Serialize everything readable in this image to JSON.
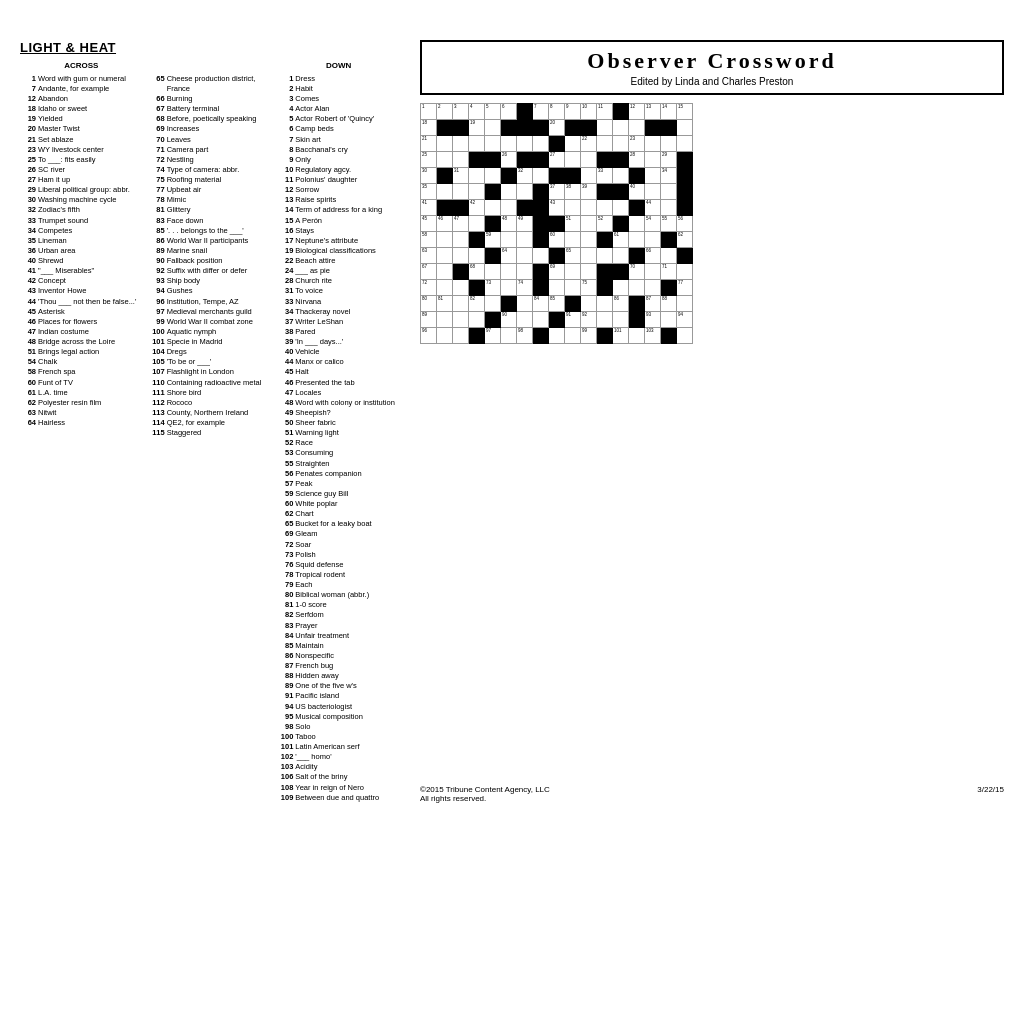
{
  "puzzle": {
    "title": "LIGHT & HEAT",
    "crossword_title": "Observer Crossword",
    "crossword_subtitle": "Edited by Linda and Charles Preston",
    "copyright": "©2015 Tribune Content Agency, LLC",
    "rights": "All rights reserved.",
    "date": "3/22/15"
  },
  "across_title": "ACROSS",
  "down_title": "DOWN",
  "across_clues": [
    {
      "num": "1",
      "text": "Word with gum or numeral"
    },
    {
      "num": "7",
      "text": "Andante, for example"
    },
    {
      "num": "12",
      "text": "Abandon"
    },
    {
      "num": "18",
      "text": "Idaho or sweet"
    },
    {
      "num": "19",
      "text": "Yielded"
    },
    {
      "num": "20",
      "text": "Master Twist"
    },
    {
      "num": "21",
      "text": "Set ablaze"
    },
    {
      "num": "23",
      "text": "WY livestock center"
    },
    {
      "num": "25",
      "text": "To ___: fits easily"
    },
    {
      "num": "26",
      "text": "SC river"
    },
    {
      "num": "27",
      "text": "Ham it up"
    },
    {
      "num": "29",
      "text": "Liberal political group: abbr."
    },
    {
      "num": "30",
      "text": "Washing machine cycle"
    },
    {
      "num": "32",
      "text": "Zodiac's fifth"
    },
    {
      "num": "33",
      "text": "Trumpet sound"
    },
    {
      "num": "34",
      "text": "Competes"
    },
    {
      "num": "35",
      "text": "Lineman"
    },
    {
      "num": "36",
      "text": "Urban area"
    },
    {
      "num": "40",
      "text": "Shrewd"
    },
    {
      "num": "41",
      "text": "\"___ Miserables\""
    },
    {
      "num": "42",
      "text": "Concept"
    },
    {
      "num": "43",
      "text": "Inventor Howe"
    },
    {
      "num": "44",
      "text": "'Thou ___ not then be false...'"
    },
    {
      "num": "45",
      "text": "Asterisk"
    },
    {
      "num": "46",
      "text": "Places for flowers"
    },
    {
      "num": "47",
      "text": "Indian costume"
    },
    {
      "num": "48",
      "text": "Bridge across the Loire"
    },
    {
      "num": "51",
      "text": "Brings legal action"
    },
    {
      "num": "54",
      "text": "Chalk"
    },
    {
      "num": "58",
      "text": "French spa"
    },
    {
      "num": "60",
      "text": "Funt of TV"
    },
    {
      "num": "61",
      "text": "L.A. time"
    },
    {
      "num": "62",
      "text": "Polyester resin film"
    },
    {
      "num": "63",
      "text": "Nitwit"
    },
    {
      "num": "64",
      "text": "Hairless"
    },
    {
      "num": "65",
      "text": "Cheese production district, France"
    },
    {
      "num": "66",
      "text": "Burning"
    },
    {
      "num": "67",
      "text": "Battery terminal"
    },
    {
      "num": "68",
      "text": "Before, poetically speaking"
    },
    {
      "num": "69",
      "text": "Increases"
    },
    {
      "num": "70",
      "text": "Leaves"
    },
    {
      "num": "71",
      "text": "Camera part"
    },
    {
      "num": "72",
      "text": "Nestling"
    },
    {
      "num": "74",
      "text": "Type of camera: abbr."
    },
    {
      "num": "75",
      "text": "Roofing material"
    },
    {
      "num": "77",
      "text": "Upbeat air"
    },
    {
      "num": "78",
      "text": "Mimic"
    },
    {
      "num": "81",
      "text": "Glittery"
    },
    {
      "num": "83",
      "text": "Face down"
    },
    {
      "num": "85",
      "text": "'. . . belongs to the ___'"
    },
    {
      "num": "86",
      "text": "World War II participants"
    },
    {
      "num": "89",
      "text": "Marine snail"
    },
    {
      "num": "90",
      "text": "Fallback position"
    },
    {
      "num": "92",
      "text": "Suffix with differ or defer"
    },
    {
      "num": "93",
      "text": "Ship body"
    },
    {
      "num": "94",
      "text": "Gushes"
    },
    {
      "num": "96",
      "text": "Institution, Tempe, AZ"
    },
    {
      "num": "97",
      "text": "Medieval merchants guild"
    },
    {
      "num": "99",
      "text": "World War II combat zone"
    },
    {
      "num": "100",
      "text": "Aquatic nymph"
    },
    {
      "num": "101",
      "text": "Specie in Madrid"
    },
    {
      "num": "104",
      "text": "Dregs"
    },
    {
      "num": "105",
      "text": "'To be or ___'"
    },
    {
      "num": "107",
      "text": "Flashlight in London"
    },
    {
      "num": "110",
      "text": "Containing radioactive metal"
    },
    {
      "num": "111",
      "text": "Shore bird"
    },
    {
      "num": "112",
      "text": "Rococo"
    },
    {
      "num": "113",
      "text": "County, Northern Ireland"
    },
    {
      "num": "114",
      "text": "QE2, for example"
    },
    {
      "num": "115",
      "text": "Staggered"
    },
    {
      "num": "50",
      "text": "Sheer fabric"
    },
    {
      "num": "51",
      "text": "Warning light"
    },
    {
      "num": "52",
      "text": "Race"
    },
    {
      "num": "53",
      "text": "Consuming"
    },
    {
      "num": "55",
      "text": "Straighten"
    },
    {
      "num": "56",
      "text": "Penates companion"
    },
    {
      "num": "57",
      "text": "Peak"
    },
    {
      "num": "59",
      "text": "Science guy Bill"
    },
    {
      "num": "60",
      "text": "White poplar"
    },
    {
      "num": "62",
      "text": "Chart"
    },
    {
      "num": "65",
      "text": "Bucket for a leaky boat"
    },
    {
      "num": "69",
      "text": "Gleam"
    },
    {
      "num": "72",
      "text": "Soar"
    },
    {
      "num": "73",
      "text": "Polish"
    },
    {
      "num": "76",
      "text": "Squid defense"
    },
    {
      "num": "78",
      "text": "Tropical rodent"
    },
    {
      "num": "79",
      "text": "Each"
    },
    {
      "num": "80",
      "text": "Biblical woman (abbr.)"
    },
    {
      "num": "81",
      "text": "1-0 score"
    },
    {
      "num": "82",
      "text": "Serfdom"
    },
    {
      "num": "83",
      "text": "Prayer"
    },
    {
      "num": "84",
      "text": "Unfair treatment"
    },
    {
      "num": "85",
      "text": "Maintain"
    },
    {
      "num": "86",
      "text": "Nonspecific"
    },
    {
      "num": "87",
      "text": "French bug"
    },
    {
      "num": "88",
      "text": "Hidden away"
    },
    {
      "num": "89",
      "text": "One of the five w's"
    },
    {
      "num": "91",
      "text": "Pacific island"
    },
    {
      "num": "94",
      "text": "US bacteriologist"
    },
    {
      "num": "95",
      "text": "Musical composition"
    },
    {
      "num": "98",
      "text": "Solo"
    },
    {
      "num": "100",
      "text": "Taboo"
    },
    {
      "num": "101",
      "text": "Latin American serf"
    },
    {
      "num": "102",
      "text": "'___ homo'"
    },
    {
      "num": "103",
      "text": "Acidity"
    },
    {
      "num": "106",
      "text": "Salt of the briny"
    },
    {
      "num": "108",
      "text": "Year in reign of Nero"
    },
    {
      "num": "109",
      "text": "Between due and quattro"
    }
  ],
  "down_clues": [
    {
      "num": "1",
      "text": "Dress"
    },
    {
      "num": "2",
      "text": "Habit"
    },
    {
      "num": "3",
      "text": "Comes"
    },
    {
      "num": "4",
      "text": "Actor Alan"
    },
    {
      "num": "5",
      "text": "Actor Robert of 'Quincy'"
    },
    {
      "num": "6",
      "text": "Camp beds"
    },
    {
      "num": "7",
      "text": "Skin art"
    },
    {
      "num": "8",
      "text": "Bacchanal's cry"
    },
    {
      "num": "9",
      "text": "Only"
    },
    {
      "num": "10",
      "text": "Regulatory agcy."
    },
    {
      "num": "11",
      "text": "Polonius' daughter"
    },
    {
      "num": "12",
      "text": "Sorrow"
    },
    {
      "num": "13",
      "text": "Raise spirits"
    },
    {
      "num": "14",
      "text": "Term of address for a king"
    },
    {
      "num": "15",
      "text": "A Perón"
    },
    {
      "num": "16",
      "text": "Stays"
    },
    {
      "num": "17",
      "text": "Neptune's attribute"
    },
    {
      "num": "19",
      "text": "Biological classifications"
    },
    {
      "num": "22",
      "text": "Beach attire"
    },
    {
      "num": "24",
      "text": "___ as pie"
    },
    {
      "num": "28",
      "text": "Church rite"
    },
    {
      "num": "31",
      "text": "To voice"
    },
    {
      "num": "33",
      "text": "Nirvana"
    },
    {
      "num": "34",
      "text": "Thackeray novel"
    },
    {
      "num": "37",
      "text": "Writer LeShan"
    },
    {
      "num": "38",
      "text": "Pared"
    },
    {
      "num": "39",
      "text": "'In ___ days...'"
    },
    {
      "num": "40",
      "text": "Vehicle"
    },
    {
      "num": "44",
      "text": "Manx or calico"
    },
    {
      "num": "45",
      "text": "Halt"
    },
    {
      "num": "46",
      "text": "Presented the tab"
    },
    {
      "num": "47",
      "text": "Locales"
    },
    {
      "num": "48",
      "text": "Word with colony or institution"
    },
    {
      "num": "49",
      "text": "Sheepish?"
    },
    {
      "num": "22",
      "text": "Beach attire"
    },
    {
      "num": "87",
      "text": "French bug"
    }
  ]
}
